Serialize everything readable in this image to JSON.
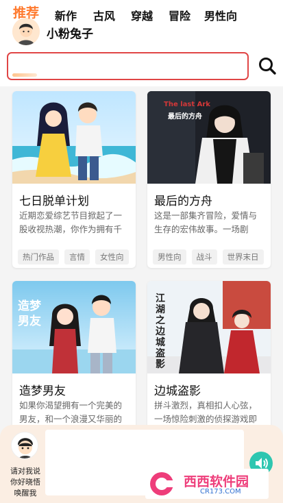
{
  "header": {
    "username": "小粉兔子"
  },
  "tabs": [
    {
      "label": "推荐",
      "active": true
    },
    {
      "label": "新作",
      "active": false
    },
    {
      "label": "古风",
      "active": false
    },
    {
      "label": "穿越",
      "active": false
    },
    {
      "label": "冒险",
      "active": false
    },
    {
      "label": "男性向",
      "active": false
    }
  ],
  "icons": {
    "search": "search-icon",
    "speaker": "speaker-icon"
  },
  "cards": [
    {
      "cover_caption": "",
      "title": "七日脱单计划",
      "desc": "近期恋爱综艺节目掀起了一股收视热潮，你作为拥有千万粉丝的人气美妆博主，...",
      "tags": [
        "热门作品",
        "言情",
        "女性向"
      ]
    },
    {
      "cover_caption": "最后的方舟",
      "cover_caption_en": "The last Ark",
      "title": "最后的方舟",
      "desc": "这是一部集齐冒险，爱情与生存的宏伟故事。一场剧变，使地球的气温在短短...",
      "tags": [
        "男性向",
        "战斗",
        "世界末日"
      ]
    },
    {
      "cover_caption": "造梦男友",
      "title": "造梦男友",
      "desc": "如果你渴望拥有一个完美的男友，和一个浪漫又华丽的",
      "tags": []
    },
    {
      "cover_caption": "江湖之边城盗影",
      "title": "边城盗影",
      "desc": "拼斗激烈，真相扣人心弦，一场惊险刺激的侦探游戏即",
      "tags": []
    }
  ],
  "bottom": {
    "bot_hint": "请对我说你好晓悟唤醒我"
  },
  "watermark": {
    "brand": "西西软件园",
    "url": "CR173.COM"
  },
  "colors": {
    "accent": "#ff7a2e",
    "tab_border": "#e04545",
    "speaker": "#2ec6b0",
    "bottom_panel": "#fbeee3"
  }
}
